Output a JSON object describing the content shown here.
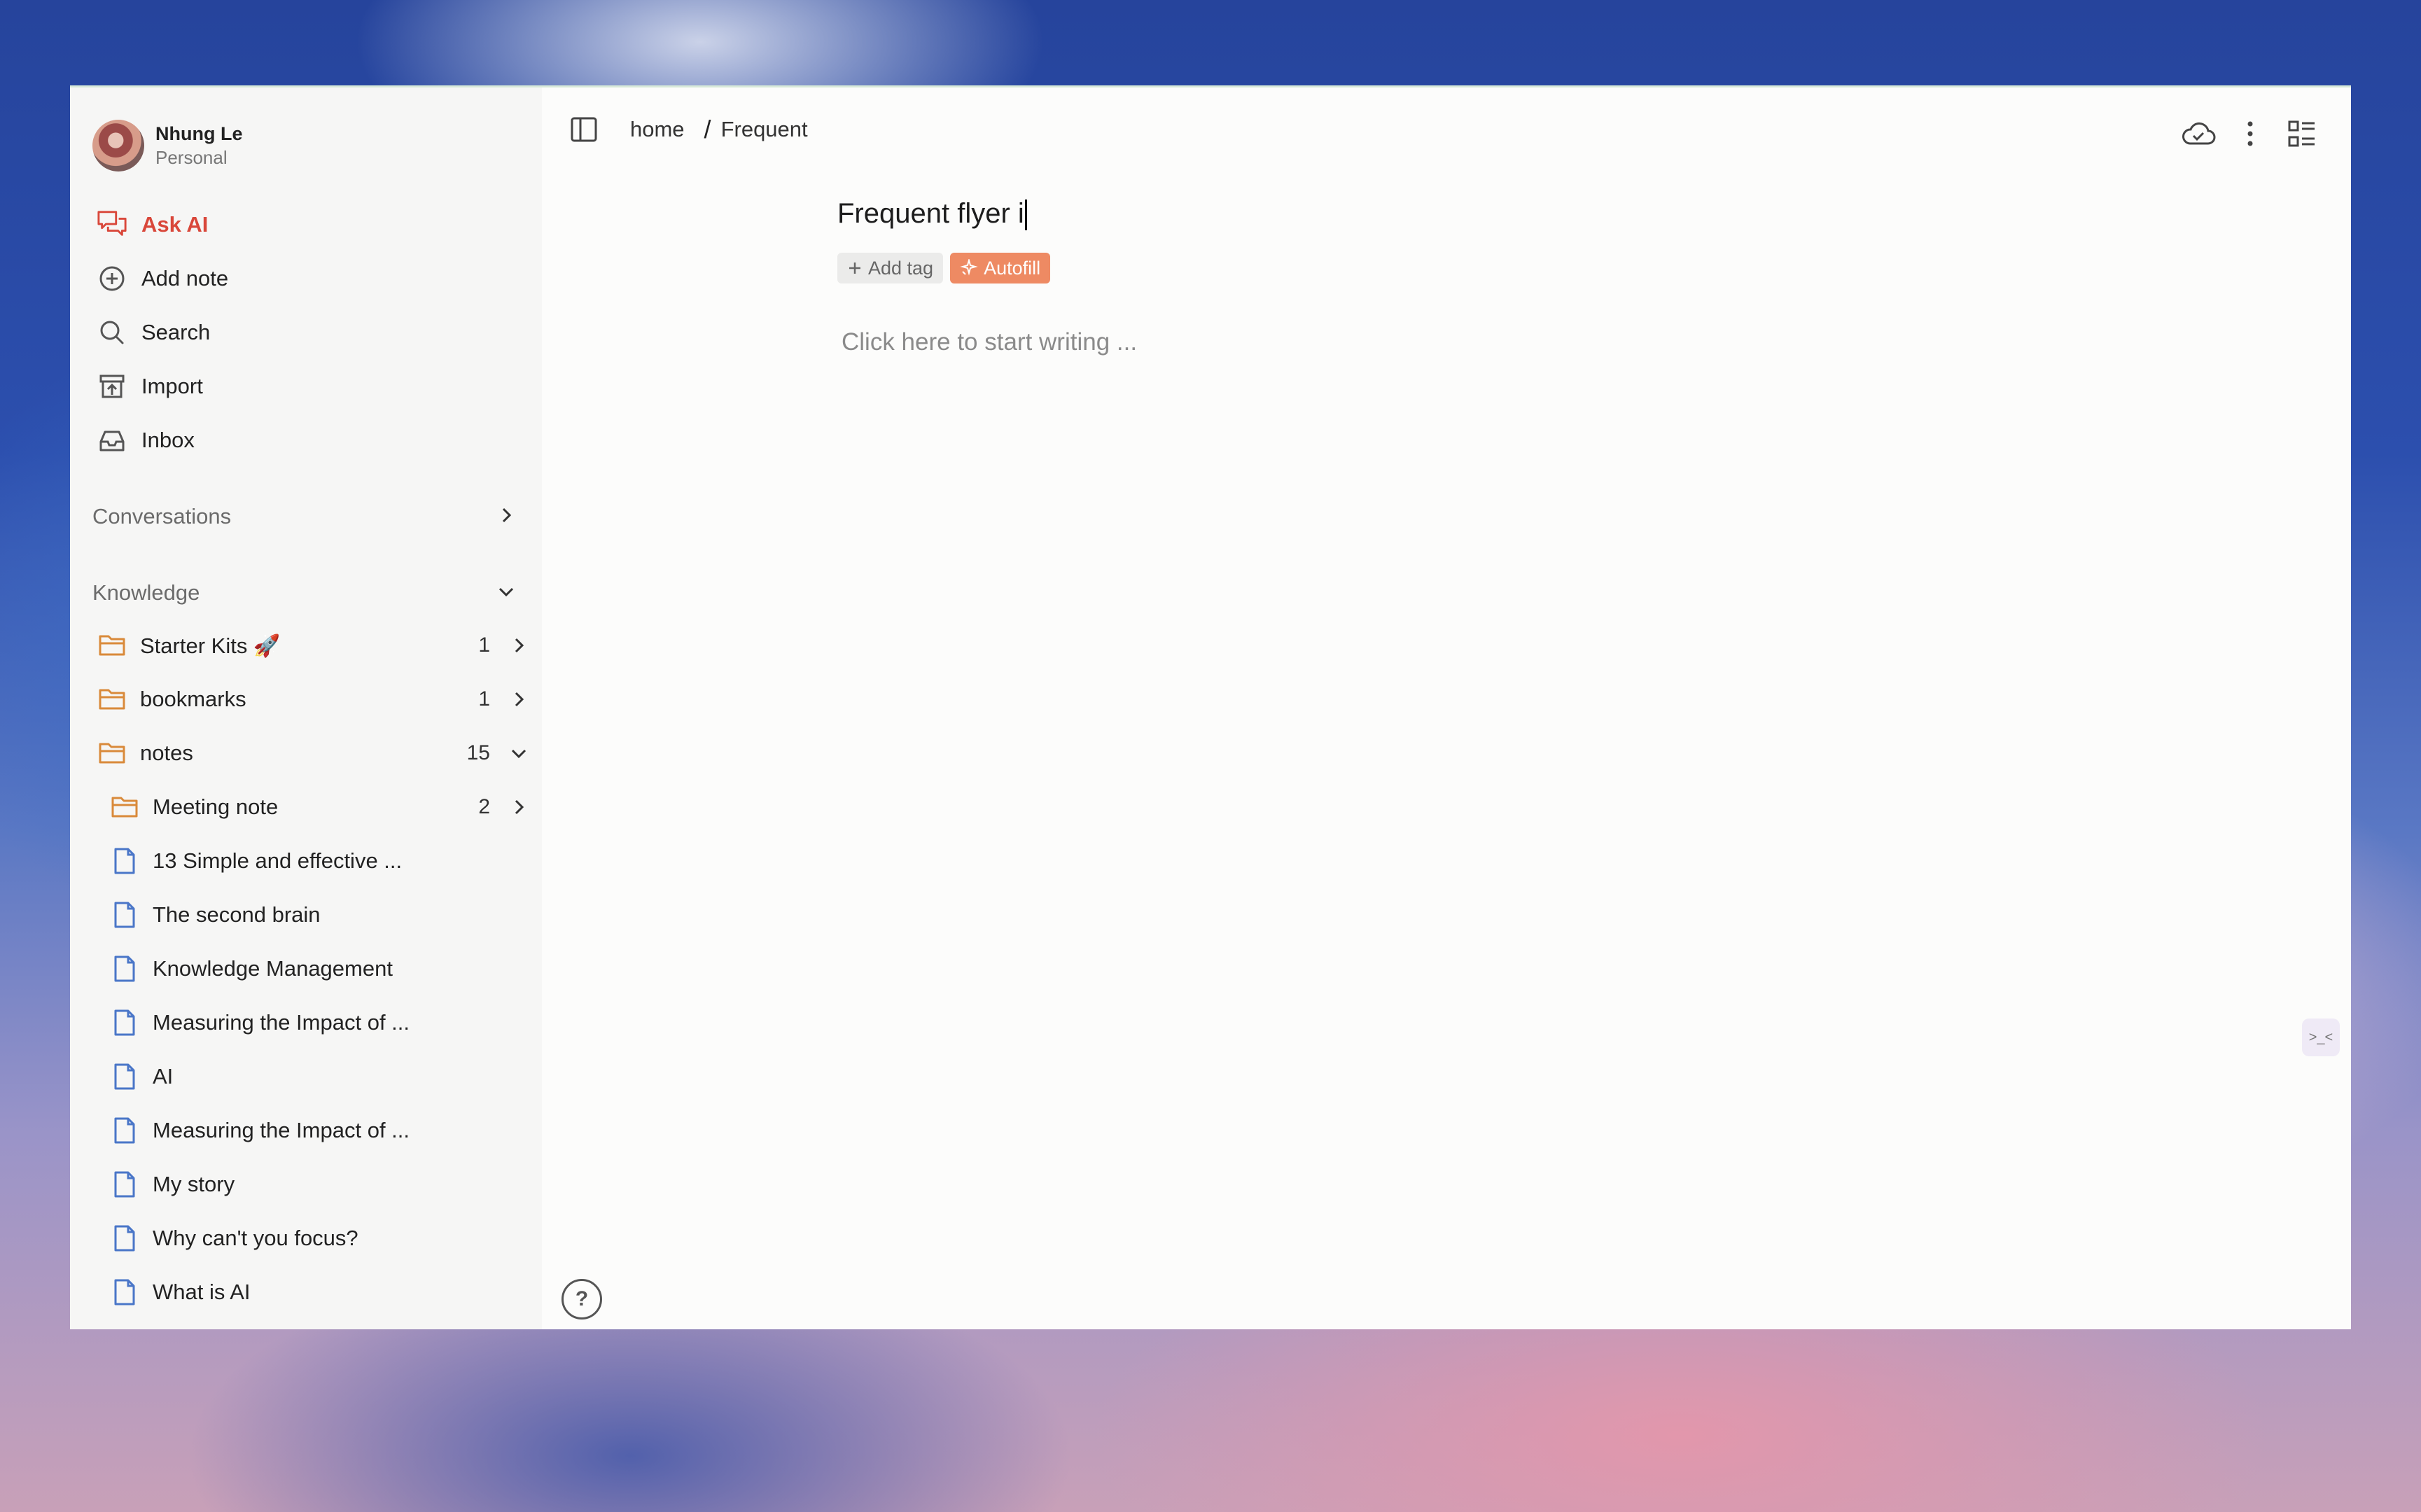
{
  "user": {
    "name": "Nhung Le",
    "workspace": "Personal"
  },
  "nav": {
    "ask_ai": "Ask AI",
    "add_note": "Add note",
    "search": "Search",
    "import": "Import",
    "inbox": "Inbox"
  },
  "sections": {
    "conversations": "Conversations",
    "knowledge": "Knowledge"
  },
  "tree": {
    "starter_kits": {
      "label": "Starter Kits 🚀",
      "count": "1"
    },
    "bookmarks": {
      "label": "bookmarks",
      "count": "1"
    },
    "notes": {
      "label": "notes",
      "count": "15"
    },
    "meeting_note": {
      "label": "Meeting note",
      "count": "2"
    },
    "docs": [
      "13 Simple and effective ...",
      "The second brain",
      "Knowledge Management",
      "Measuring the Impact of ...",
      "AI",
      "Measuring the Impact of ...",
      "My story",
      "Why can't you focus?",
      "What is AI"
    ]
  },
  "breadcrumb": {
    "home": "home",
    "sep": "/",
    "current": "Frequent"
  },
  "editor": {
    "title": "Frequent flyer i",
    "add_tag": "Add tag",
    "autofill": "Autofill",
    "placeholder": "Click here to start writing ..."
  },
  "help": "?",
  "widget": ">_<",
  "colors": {
    "accent": "#d9473a",
    "autofill": "#ee8a63",
    "folder": "#d98a3a",
    "doc": "#4a76c8"
  }
}
